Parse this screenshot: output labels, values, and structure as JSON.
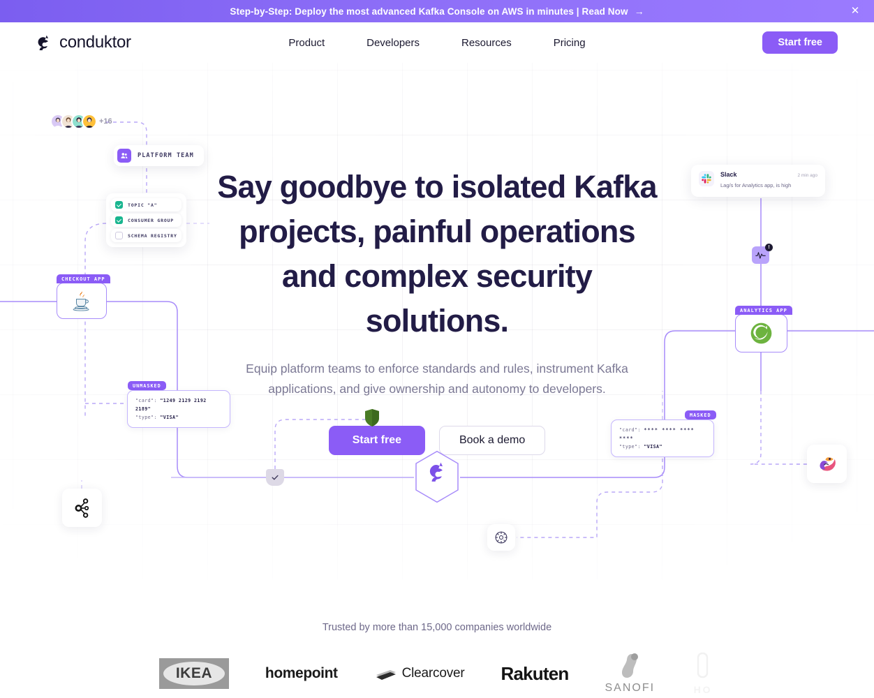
{
  "banner": {
    "text": "Step-by-Step: Deploy the most advanced Kafka Console on AWS in minutes | Read Now",
    "arrow": "→",
    "close_icon": "close-icon",
    "close_glyph": "✕",
    "background_color": "#8b5cf6"
  },
  "header": {
    "logo_text": "conduktor",
    "logo_icon": "conduktor-wolf-logo",
    "nav": [
      {
        "label": "Product"
      },
      {
        "label": "Developers"
      },
      {
        "label": "Resources"
      },
      {
        "label": "Pricing"
      }
    ],
    "cta_label": "Start free",
    "accent_color": "#8b5cf6"
  },
  "hero": {
    "heading": "Say goodbye to isolated Kafka projects, painful operations and complex security solutions.",
    "subheading": "Equip platform teams to enforce standards and rules, instrument Kafka applications, and give ownership and autonomy to developers.",
    "primary_cta": "Start free",
    "secondary_cta": "Book a demo",
    "heading_color": "#221c46",
    "subheading_color": "#7b7894"
  },
  "diagram": {
    "avatars": {
      "count_label": "+16",
      "avatar_icon": "user-avatar"
    },
    "platform_team": {
      "label": "PLATFORM TEAM",
      "icon": "team-users-icon"
    },
    "resources": [
      {
        "label": "TOPIC \"A\"",
        "checked": true
      },
      {
        "label": "CONSUMER GROUP",
        "checked": true
      },
      {
        "label": "SCHEMA REGISTRY",
        "checked": false
      }
    ],
    "checkout_app": {
      "tag": "CHECKOUT APP",
      "icon": "java-coffee-cup-icon"
    },
    "analytics_app": {
      "tag": "ANALYTICS APP",
      "icon": "spring-boot-leaf-icon"
    },
    "unmasked": {
      "tag": "UNMASKED",
      "line1_key": "\"card\":",
      "line1_value": "\"1249 2129 2192 2189\"",
      "line2_key": "\"type\":",
      "line2_value": "\"VISA\""
    },
    "masked": {
      "tag": "MASKED",
      "line1_key": "\"card\":",
      "line1_value": "**** **** **** ****",
      "line2_key": "\"type\":",
      "line2_value": "\"VISA\""
    },
    "slack": {
      "title": "Slack",
      "time": "2 min ago",
      "message": "Lag/s for Analytics app, is high",
      "icon": "slack-icon"
    },
    "monitor_chip": {
      "icon": "pulse-monitor-icon",
      "badge": "!"
    },
    "tiles": [
      {
        "name": "kafka-tile",
        "icon": "apache-kafka-icon"
      },
      {
        "name": "datadog-tile",
        "icon": "datadog-icon"
      },
      {
        "name": "gear-tile",
        "icon": "gear-icon"
      },
      {
        "name": "shield-tile",
        "icon": "green-shield-icon"
      },
      {
        "name": "check-tile",
        "icon": "check-shield-icon"
      }
    ],
    "center_node": {
      "icon": "conduktor-hexagon-logo"
    },
    "line_color": "#a78bfa"
  },
  "trusted": {
    "label": "Trusted by more than 15,000 companies worldwide",
    "logos": [
      {
        "name": "ikea",
        "text": "IKEA"
      },
      {
        "name": "homepoint",
        "text": "homepoint"
      },
      {
        "name": "clearcover",
        "text": "Clearcover"
      },
      {
        "name": "rakuten",
        "text": "Rakuten"
      },
      {
        "name": "sanofi",
        "text": "SANOFI"
      },
      {
        "name": "honda",
        "text": "HO"
      }
    ]
  }
}
